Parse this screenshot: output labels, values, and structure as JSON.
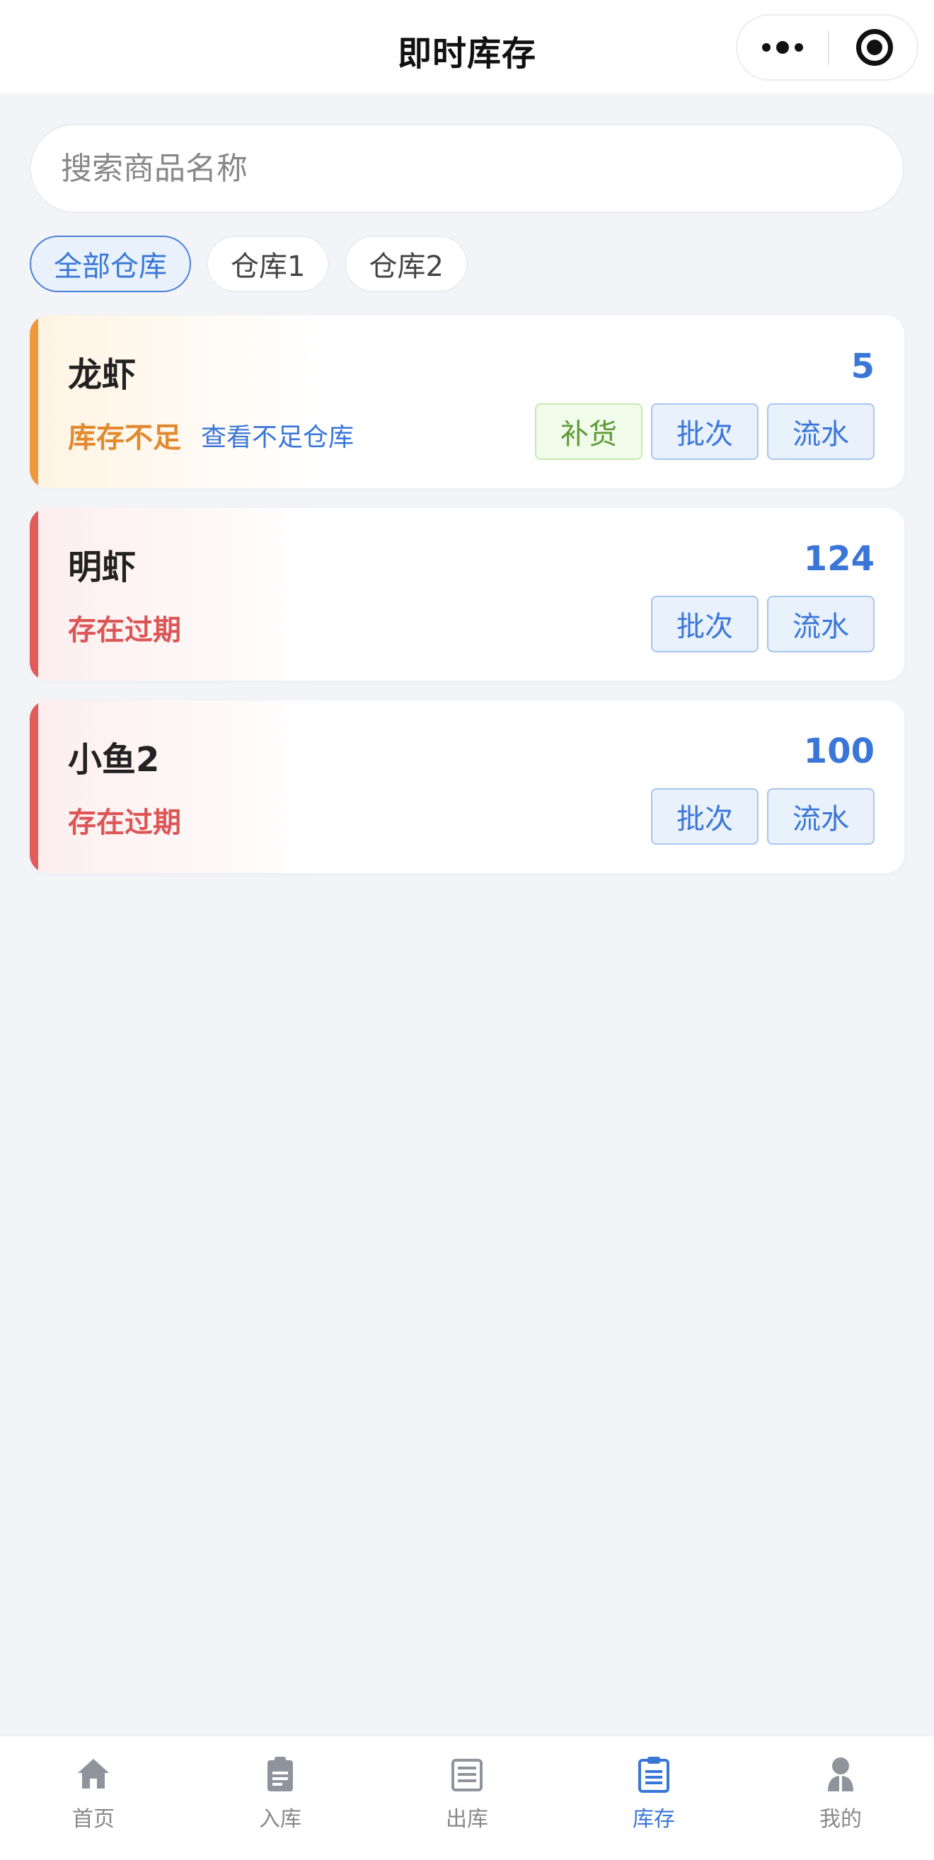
{
  "header": {
    "title": "即时库存"
  },
  "search": {
    "placeholder": "搜索商品名称"
  },
  "filters": [
    {
      "label": "全部仓库",
      "active": true
    },
    {
      "label": "仓库1",
      "active": false
    },
    {
      "label": "仓库2",
      "active": false
    }
  ],
  "items": [
    {
      "name": "龙虾",
      "quantity": "5",
      "status": "库存不足",
      "status_type": "warning",
      "link": "查看不足仓库",
      "buttons": {
        "restock": "补货",
        "batch": "批次",
        "flow": "流水"
      }
    },
    {
      "name": "明虾",
      "quantity": "124",
      "status": "存在过期",
      "status_type": "expired",
      "buttons": {
        "batch": "批次",
        "flow": "流水"
      }
    },
    {
      "name": "小鱼2",
      "quantity": "100",
      "status": "存在过期",
      "status_type": "expired",
      "buttons": {
        "batch": "批次",
        "flow": "流水"
      }
    }
  ],
  "tabbar": [
    {
      "label": "首页",
      "icon": "home-icon",
      "active": false
    },
    {
      "label": "入库",
      "icon": "clipboard-icon",
      "active": false
    },
    {
      "label": "出库",
      "icon": "list-icon",
      "active": false
    },
    {
      "label": "库存",
      "icon": "inventory-icon",
      "active": true
    },
    {
      "label": "我的",
      "icon": "user-icon",
      "active": false
    }
  ],
  "colors": {
    "accent": "#3a76d8",
    "warning": "#ef9a3a",
    "expired": "#e25c5c",
    "restock": "#5c9a37"
  }
}
